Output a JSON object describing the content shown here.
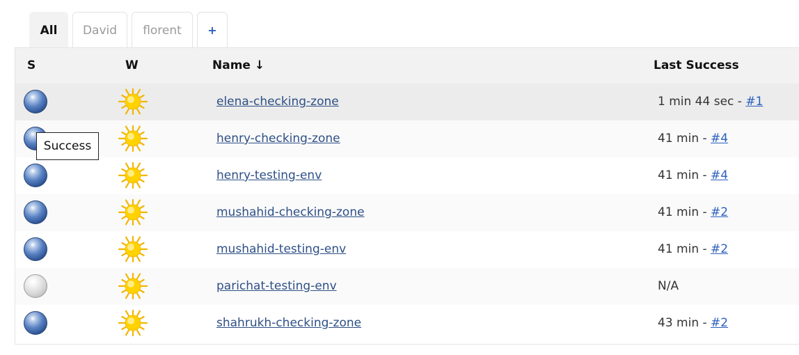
{
  "tabs": [
    {
      "label": "All",
      "active": true
    },
    {
      "label": "David",
      "active": false
    },
    {
      "label": "florent",
      "active": false
    },
    {
      "label": "+",
      "active": false
    }
  ],
  "table": {
    "headers": {
      "status": "S",
      "weather": "W",
      "name": "Name ↓",
      "last_success": "Last Success"
    },
    "rows": [
      {
        "name": "elena-checking-zone",
        "status": "blue",
        "weather": "sunny",
        "last_success_text": "1 min 44 sec - ",
        "build": "#1"
      },
      {
        "name": "henry-checking-zone",
        "status": "blue",
        "weather": "sunny",
        "last_success_text": "41 min - ",
        "build": "#4"
      },
      {
        "name": "henry-testing-env",
        "status": "blue",
        "weather": "sunny",
        "last_success_text": "41 min - ",
        "build": "#4"
      },
      {
        "name": "mushahid-checking-zone",
        "status": "blue",
        "weather": "sunny",
        "last_success_text": "41 min - ",
        "build": "#2"
      },
      {
        "name": "mushahid-testing-env",
        "status": "blue",
        "weather": "sunny",
        "last_success_text": "41 min - ",
        "build": "#2"
      },
      {
        "name": "parichat-testing-env",
        "status": "grey",
        "weather": "sunny",
        "last_success_text": "N/A",
        "build": ""
      },
      {
        "name": "shahrukh-checking-zone",
        "status": "blue",
        "weather": "sunny",
        "last_success_text": "43 min - ",
        "build": "#2"
      }
    ]
  },
  "tooltip": {
    "text": "Success"
  },
  "colors": {
    "link": "#2e4f86",
    "build_link": "#2b5fbd",
    "header_bg": "#f2f2f2",
    "status_blue": "#2a4f8f",
    "status_grey": "#d6d6d6",
    "sun": "#ffd200"
  }
}
